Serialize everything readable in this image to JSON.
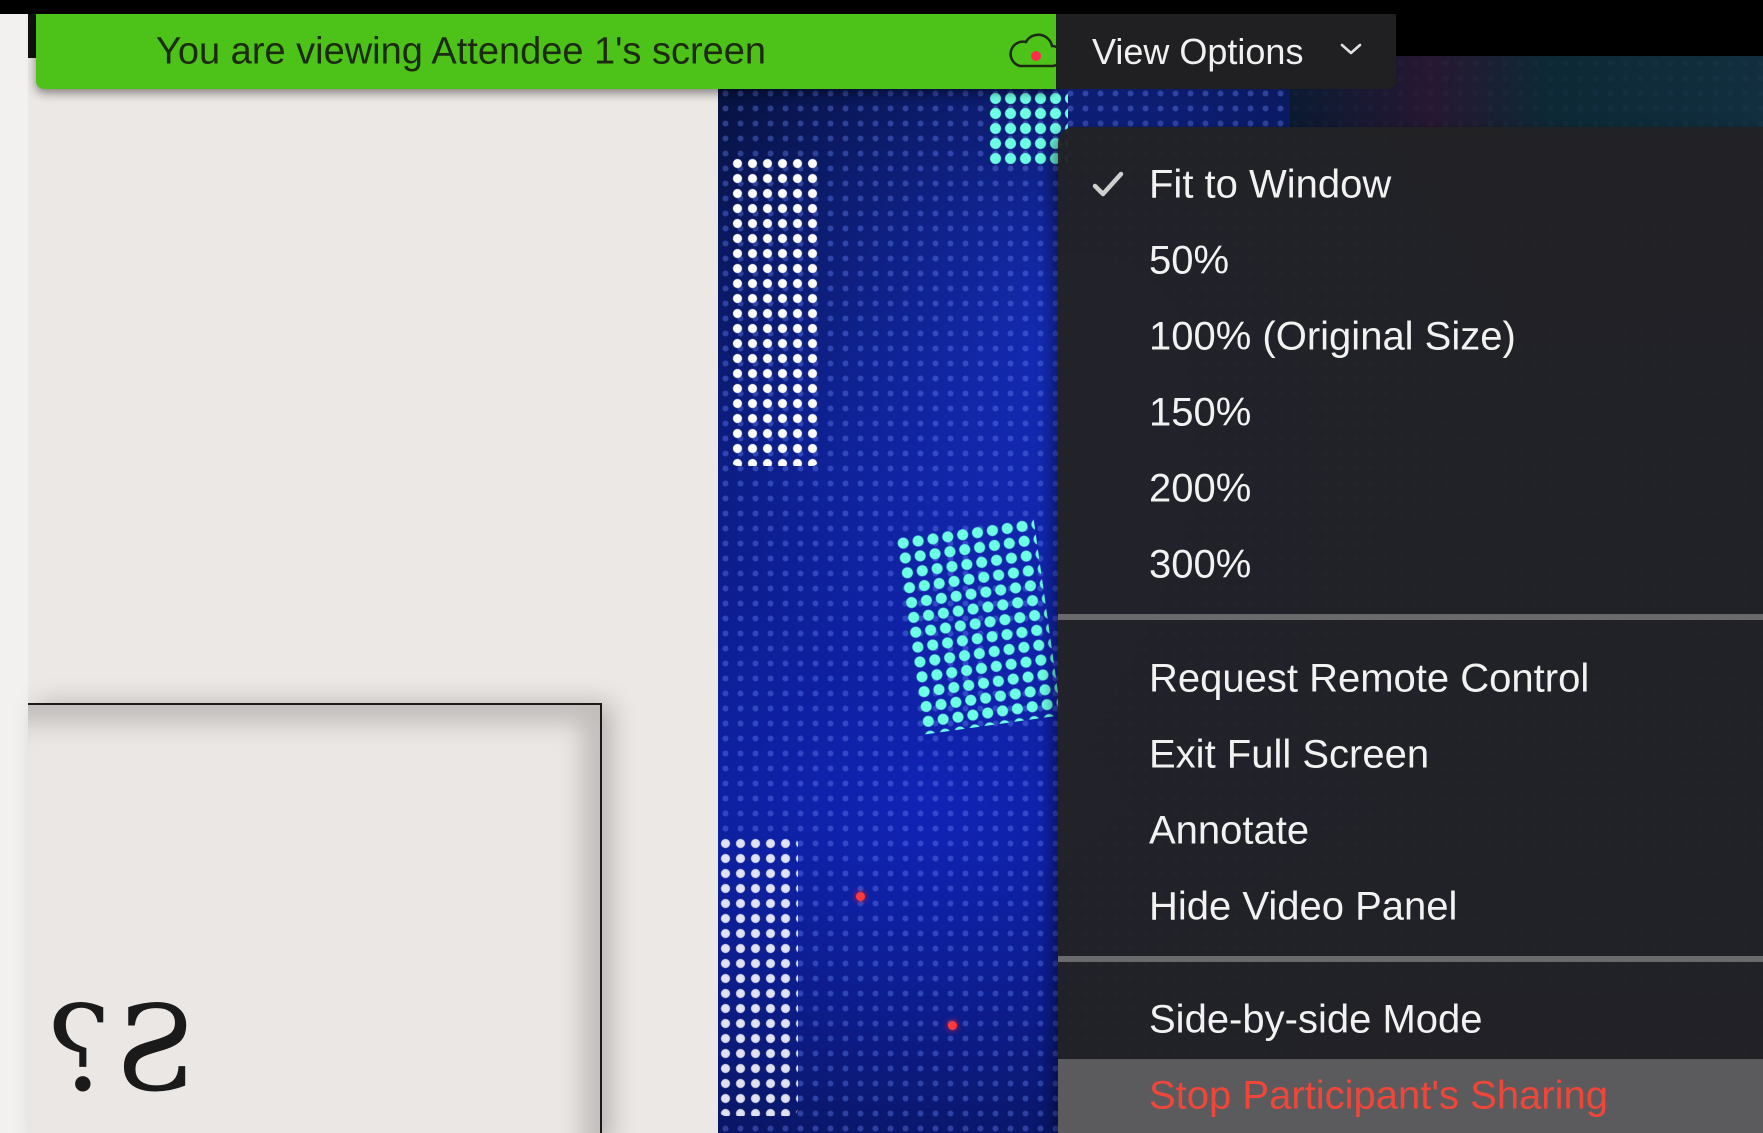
{
  "banner": {
    "text": "You are viewing Attendee 1's screen",
    "color": "#4dc218",
    "recording_icon": "cloud-recording-icon"
  },
  "view_options": {
    "label": "View Options",
    "icon": "chevron-down-icon"
  },
  "shared_slide": {
    "visible_text": "S?"
  },
  "menu": {
    "groups": [
      [
        {
          "label": "Fit to Window",
          "checked": true
        },
        {
          "label": "50%",
          "checked": false
        },
        {
          "label": "100% (Original Size)",
          "checked": false
        },
        {
          "label": "150%",
          "checked": false
        },
        {
          "label": "200%",
          "checked": false
        },
        {
          "label": "300%",
          "checked": false
        }
      ],
      [
        {
          "label": "Request Remote Control"
        },
        {
          "label": "Exit Full Screen"
        },
        {
          "label": "Annotate"
        },
        {
          "label": "Hide Video Panel"
        }
      ],
      [
        {
          "label": "Side-by-side Mode"
        },
        {
          "label": "Stop Participant's Sharing",
          "danger": true
        }
      ]
    ],
    "danger_color": "#f0463a",
    "highlight_color": "#5b5b5d"
  }
}
